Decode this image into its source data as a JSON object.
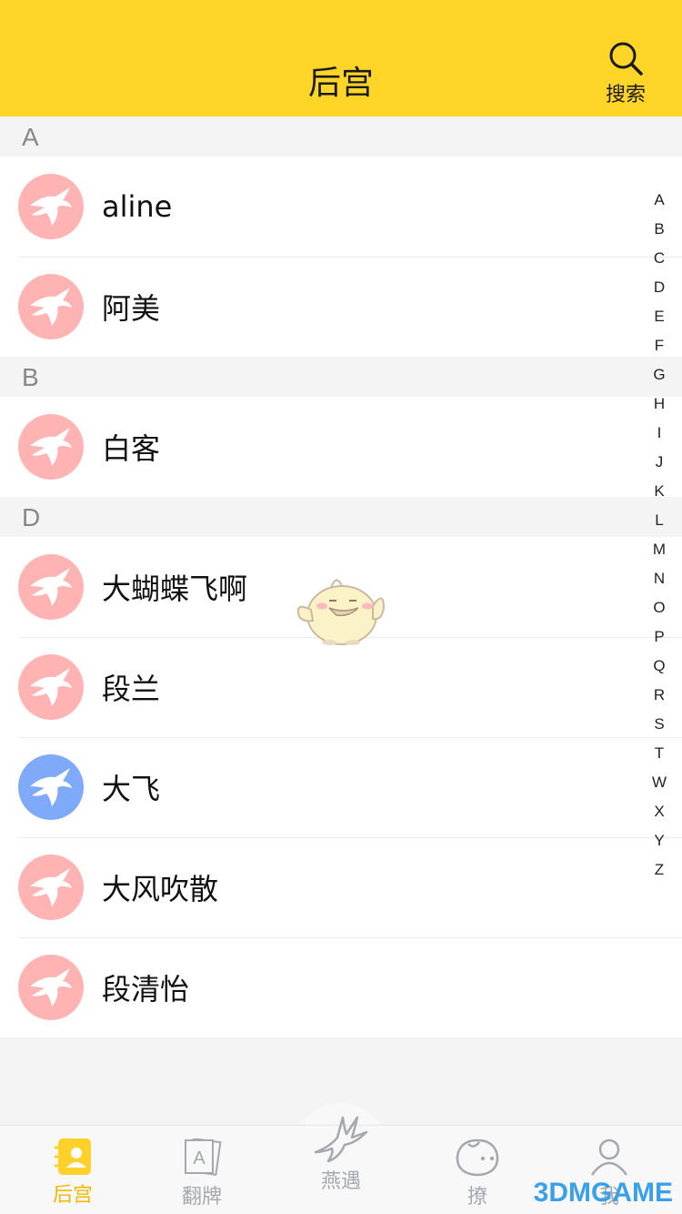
{
  "header": {
    "title": "后宫",
    "search_label": "搜索"
  },
  "sections": [
    {
      "letter": "A",
      "contacts": [
        {
          "name": "aline",
          "avatar_color": "#ffb3b3"
        },
        {
          "name": "阿美",
          "avatar_color": "#ffb3b3"
        }
      ]
    },
    {
      "letter": "B",
      "contacts": [
        {
          "name": "白客",
          "avatar_color": "#ffb3b3"
        }
      ]
    },
    {
      "letter": "D",
      "contacts": [
        {
          "name": "大蝴蝶飞啊",
          "avatar_color": "#ffb3b3"
        },
        {
          "name": "段兰",
          "avatar_color": "#ffb3b3"
        },
        {
          "name": "大飞",
          "avatar_color": "#7eaaf9"
        },
        {
          "name": "大风吹散",
          "avatar_color": "#ffb3b3"
        },
        {
          "name": "段清怡",
          "avatar_color": "#ffb3b3"
        }
      ]
    }
  ],
  "alphabet": [
    "A",
    "B",
    "C",
    "D",
    "E",
    "F",
    "G",
    "H",
    "I",
    "J",
    "K",
    "L",
    "M",
    "N",
    "O",
    "P",
    "Q",
    "R",
    "S",
    "T",
    "W",
    "X",
    "Y",
    "Z"
  ],
  "tabs": [
    {
      "label": "后宫",
      "icon": "contacts-icon",
      "active": true
    },
    {
      "label": "翻牌",
      "icon": "cards-icon",
      "active": false
    },
    {
      "label": "燕遇",
      "icon": "swallow-icon",
      "active": false
    },
    {
      "label": "撩",
      "icon": "chat-bubble-icon",
      "active": false
    },
    {
      "label": "我",
      "icon": "user-icon",
      "active": false
    }
  ],
  "watermark": "3DMGAME",
  "colors": {
    "header": "#ffd628",
    "accent": "#f5b800",
    "inactive": "#a5a8b0"
  }
}
